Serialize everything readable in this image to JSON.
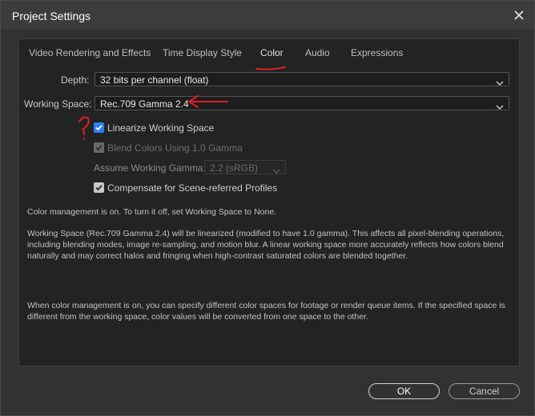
{
  "window": {
    "title": "Project Settings"
  },
  "tabs": [
    {
      "label": "Video Rendering and Effects"
    },
    {
      "label": "Time Display Style"
    },
    {
      "label": "Color"
    },
    {
      "label": "Audio"
    },
    {
      "label": "Expressions"
    }
  ],
  "color": {
    "depth_label": "Depth:",
    "depth_value": "32 bits per channel (float)",
    "working_space_label": "Working Space:",
    "working_space_value": "Rec.709 Gamma 2.4",
    "linearize_label": "Linearize Working Space",
    "linearize_checked": true,
    "blend_label": "Blend Colors Using 1.0 Gamma",
    "blend_checked": true,
    "blend_enabled": false,
    "assume_gamma_label": "Assume Working Gamma:",
    "assume_gamma_value": "2.2 (sRGB)",
    "compensate_label": "Compensate for Scene-referred Profiles",
    "compensate_checked": true,
    "info_1": "Color management is on. To turn it off, set Working Space to None.",
    "info_2": "Working Space (Rec.709 Gamma 2.4) will be linearized (modified to have 1.0 gamma). This affects all pixel-blending operations, including blending modes, image re-sampling, and motion blur. A linear working space more accurately reflects how colors blend naturally and may correct halos and fringing when high-contrast saturated colors are blended together.",
    "info_3": "When color management is on, you can specify different color spaces for footage or render queue items. If the specified space is different from the working space, color values will be converted from one space to the other."
  },
  "buttons": {
    "ok": "OK",
    "cancel": "Cancel"
  },
  "colors": {
    "annotation": "#e02020",
    "accent": "#2f7ef3"
  }
}
